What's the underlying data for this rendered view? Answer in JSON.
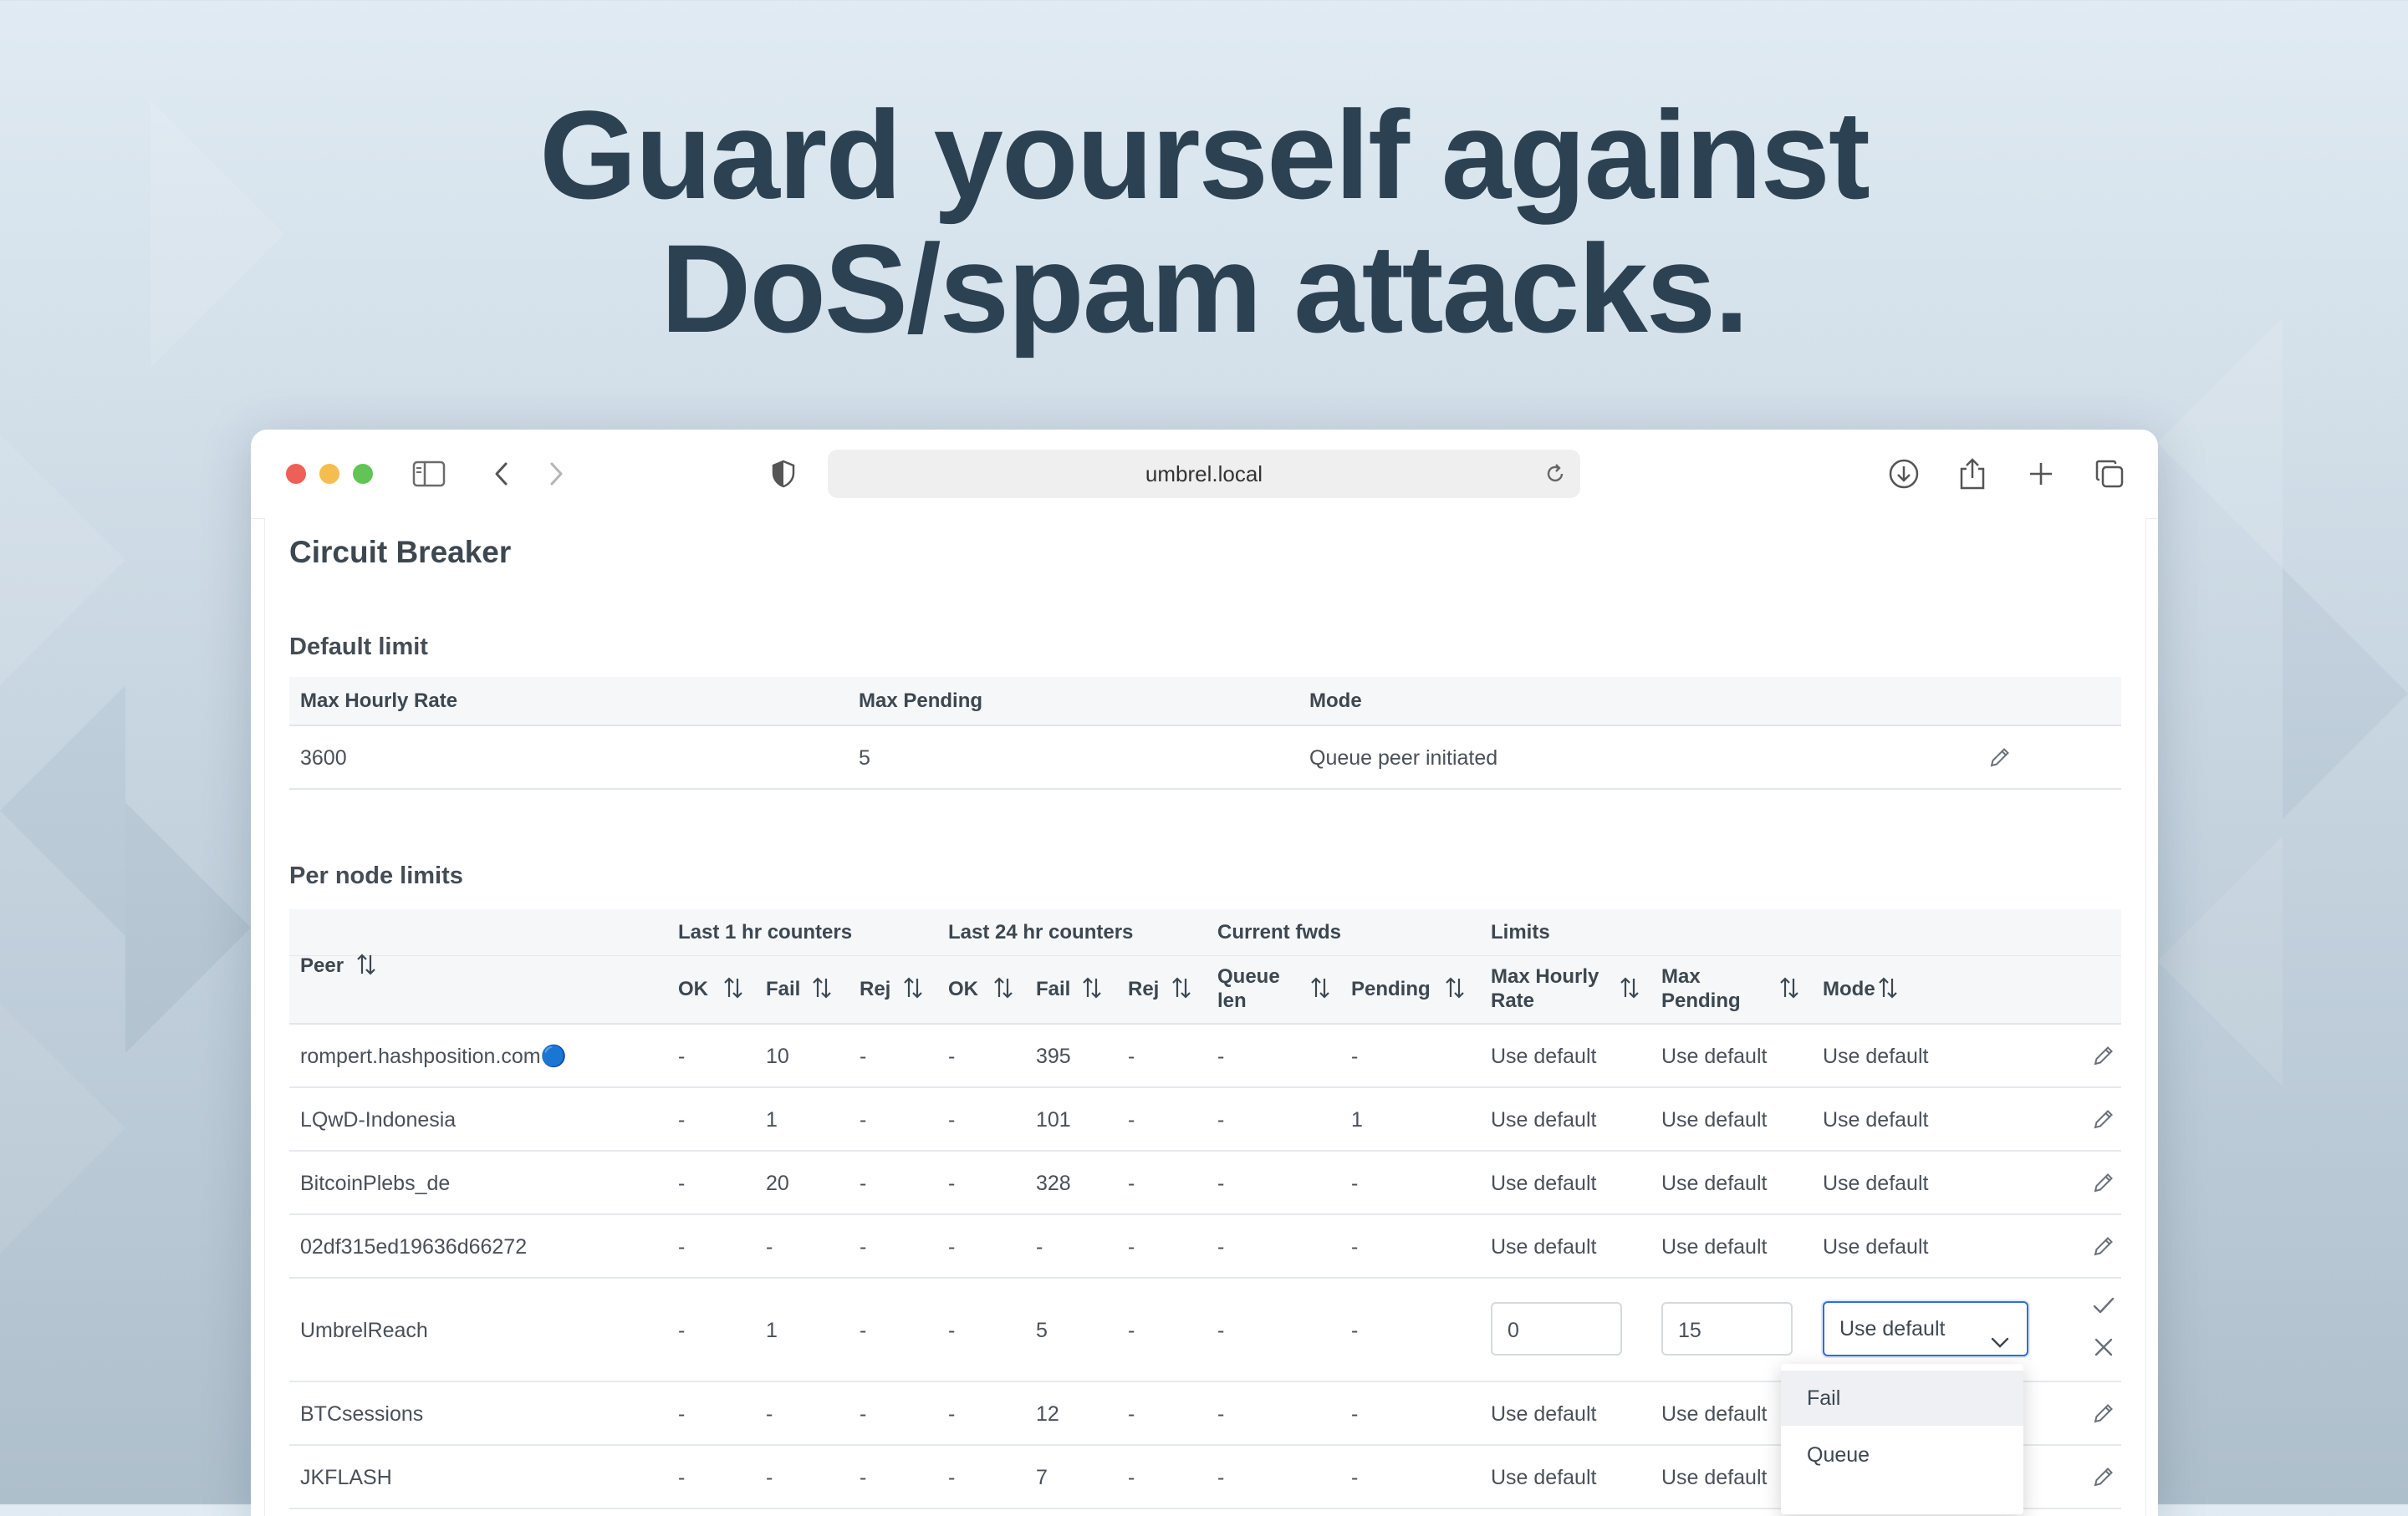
{
  "hero": {
    "line1": "Guard yourself against",
    "line2": "DoS/spam attacks."
  },
  "browser": {
    "url": "umbrel.local",
    "icons": [
      "sidebar-icon",
      "back-icon",
      "forward-icon",
      "shield-icon",
      "reload-icon",
      "download-icon",
      "share-icon",
      "new-tab-icon",
      "tabs-overview-icon"
    ]
  },
  "page": {
    "title": "Circuit Breaker",
    "default_limit": {
      "heading": "Default limit",
      "headers": {
        "max_hourly_rate": "Max Hourly Rate",
        "max_pending": "Max Pending",
        "mode": "Mode"
      },
      "row": {
        "max_hourly_rate": "3600",
        "max_pending": "5",
        "mode": "Queue peer initiated"
      }
    },
    "per_node": {
      "heading": "Per node limits",
      "groups": {
        "last1": "Last 1 hr counters",
        "last24": "Last 24 hr counters",
        "current": "Current fwds",
        "limits": "Limits"
      },
      "columns": {
        "peer": "Peer",
        "ok1": "OK",
        "fail1": "Fail",
        "rej1": "Rej",
        "ok24": "OK",
        "fail24": "Fail",
        "rej24": "Rej",
        "queue_len_1": "Queue",
        "queue_len_2": "len",
        "pending": "Pending",
        "max_hourly_1": "Max Hourly",
        "max_hourly_2": "Rate",
        "max_pending_1": "Max",
        "max_pending_2": "Pending",
        "mode": "Mode"
      },
      "rows": [
        {
          "peer": "rompert.hashposition.com🔵",
          "ok1": "-",
          "fail1": "10",
          "rej1": "-",
          "ok24": "-",
          "fail24": "395",
          "rej24": "-",
          "queue": "-",
          "pending": "-",
          "rate": "Use default",
          "maxp": "Use default",
          "mode": "Use default"
        },
        {
          "peer": "LQwD-Indonesia",
          "ok1": "-",
          "fail1": "1",
          "rej1": "-",
          "ok24": "-",
          "fail24": "101",
          "rej24": "-",
          "queue": "-",
          "pending": "1",
          "rate": "Use default",
          "maxp": "Use default",
          "mode": "Use default"
        },
        {
          "peer": "BitcoinPlebs_de",
          "ok1": "-",
          "fail1": "20",
          "rej1": "-",
          "ok24": "-",
          "fail24": "328",
          "rej24": "-",
          "queue": "-",
          "pending": "-",
          "rate": "Use default",
          "maxp": "Use default",
          "mode": "Use default"
        },
        {
          "peer": "02df315ed19636d66272",
          "ok1": "-",
          "fail1": "-",
          "rej1": "-",
          "ok24": "-",
          "fail24": "-",
          "rej24": "-",
          "queue": "-",
          "pending": "-",
          "rate": "Use default",
          "maxp": "Use default",
          "mode": "Use default"
        },
        {
          "peer": "UmbrelReach",
          "ok1": "-",
          "fail1": "1",
          "rej1": "-",
          "ok24": "-",
          "fail24": "5",
          "rej24": "-",
          "queue": "-",
          "pending": "-",
          "rate": "0",
          "maxp": "15",
          "mode": "Use default"
        },
        {
          "peer": "BTCsessions",
          "ok1": "-",
          "fail1": "-",
          "rej1": "-",
          "ok24": "-",
          "fail24": "12",
          "rej24": "-",
          "queue": "-",
          "pending": "-",
          "rate": "Use default",
          "maxp": "Use default",
          "mode": ""
        },
        {
          "peer": "JKFLASH",
          "ok1": "-",
          "fail1": "-",
          "rej1": "-",
          "ok24": "-",
          "fail24": "7",
          "rej24": "-",
          "queue": "-",
          "pending": "-",
          "rate": "Use default",
          "maxp": "Use default",
          "mode": ""
        }
      ],
      "editing": {
        "rate_value": "0",
        "pending_value": "15",
        "mode_selected": "Use default"
      },
      "mode_options": [
        "Fail",
        "Queue"
      ]
    }
  },
  "colors": {
    "accent": "#2f6fd8",
    "heading": "#2c4253",
    "close": "#ee5f57",
    "minimize": "#f5bd4f",
    "zoom": "#61c454"
  }
}
